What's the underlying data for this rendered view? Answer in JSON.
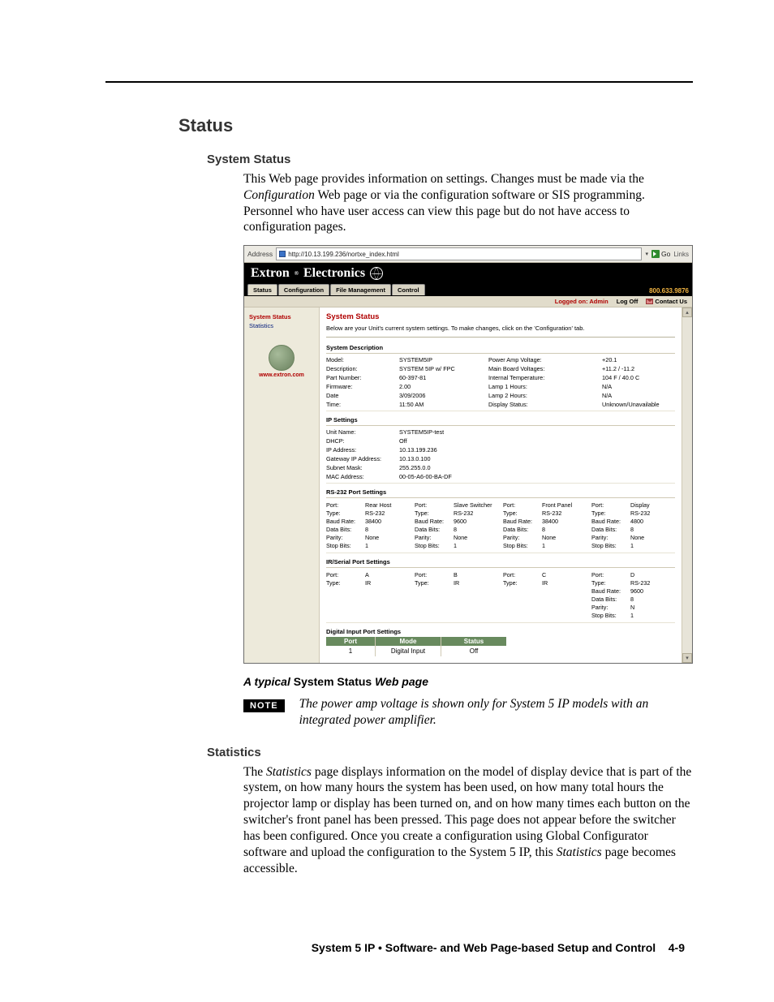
{
  "page": {
    "h1": "Status",
    "h2a": "System Status",
    "p1a": "This Web page provides information on settings.  Changes must be made via the ",
    "p1b": "Configuration",
    "p1c": " Web page or via the configuration software or SIS programming. Personnel who have user access can view this page but do not have access to configuration pages.",
    "caption_a": "A typical",
    "caption_b": " System Status ",
    "caption_c": "Web page",
    "note_label": "NOTE",
    "note_text": "The power amp voltage is shown only for System 5 IP models with an integrated power amplifier.",
    "h2b": "Statistics",
    "p2a": "The ",
    "p2b": "Statistics",
    "p2c": " page displays information on the model of display device that is part of the system, on how many hours the system has been used, on how many total hours the projector lamp or display has been turned on, and on how many times each button on the switcher's front panel has been pressed.  This page does not appear before the switcher has been configured.  Once you create a configuration using Global Configurator software and upload the configuration to the System 5 IP, this ",
    "p2d": "Statistics",
    "p2e": " page becomes accessible.",
    "footer_a": "System 5 IP • Software- and Web Page-based Setup and Control",
    "footer_b": "4-9"
  },
  "shot": {
    "addr_label": "Address",
    "addr_url": "http://10.13.199.236/nortxe_index.html",
    "go": "Go",
    "links": "Links",
    "brand_a": "Extron",
    "brand_b": "Electronics",
    "tabs": [
      "Status",
      "Configuration",
      "File Management",
      "Control"
    ],
    "phone": "800.633.9876",
    "logon": "Logged on: Admin",
    "logoff": "Log Off",
    "contact": "Contact Us",
    "side_links": [
      "System Status",
      "Statistics"
    ],
    "side_url": "www.extron.com",
    "main_title": "System Status",
    "main_sub": "Below are your Unit's current system settings. To make changes, click on the 'Configuration' tab.",
    "sys_desc_head": "System Description",
    "sys_left": [
      {
        "k": "Model:",
        "v": "SYSTEM5IP"
      },
      {
        "k": "Description:",
        "v": "SYSTEM 5IP w/ FPC"
      },
      {
        "k": "Part Number:",
        "v": "60-397-81"
      },
      {
        "k": "Firmware:",
        "v": "2.00"
      },
      {
        "k": "Date",
        "v": "3/09/2006"
      },
      {
        "k": "Time:",
        "v": "11:50 AM"
      }
    ],
    "sys_mid": [
      {
        "k": "Power Amp Voltage:",
        "v": "+20.1"
      },
      {
        "k": "Main Board Voltages:",
        "v": "+11.2 / -11.2"
      },
      {
        "k": "Internal Temperature:",
        "v": "104 F / 40.0 C"
      },
      {
        "k": "Lamp 1 Hours:",
        "v": "N/A"
      },
      {
        "k": "Lamp 2 Hours:",
        "v": "N/A"
      },
      {
        "k": "Display Status:",
        "v": "Unknown/Unavailable"
      }
    ],
    "ip_head": "IP Settings",
    "ip": [
      {
        "k": "Unit Name:",
        "v": "SYSTEM5IP-test"
      },
      {
        "k": "DHCP:",
        "v": "Off"
      },
      {
        "k": "IP Address:",
        "v": "10.13.199.236"
      },
      {
        "k": "Gateway IP Address:",
        "v": "10.13.0.100"
      },
      {
        "k": "Subnet Mask:",
        "v": "255.255.0.0"
      },
      {
        "k": "MAC Address:",
        "v": "00-05-A6-00-BA-DF"
      }
    ],
    "rs_head": "RS-232 Port Settings",
    "rs_ports": [
      [
        {
          "k": "Port:",
          "v": "Rear Host"
        },
        {
          "k": "Type:",
          "v": "RS-232"
        },
        {
          "k": "Baud Rate:",
          "v": "38400"
        },
        {
          "k": "Data Bits:",
          "v": "8"
        },
        {
          "k": "Parity:",
          "v": "None"
        },
        {
          "k": "Stop Bits:",
          "v": "1"
        }
      ],
      [
        {
          "k": "Port:",
          "v": "Slave Switcher"
        },
        {
          "k": "Type:",
          "v": "RS-232"
        },
        {
          "k": "Baud Rate:",
          "v": "9600"
        },
        {
          "k": "Data Bits:",
          "v": "8"
        },
        {
          "k": "Parity:",
          "v": "None"
        },
        {
          "k": "Stop Bits:",
          "v": "1"
        }
      ],
      [
        {
          "k": "Port:",
          "v": "Front Panel"
        },
        {
          "k": "Type:",
          "v": "RS-232"
        },
        {
          "k": "Baud Rate:",
          "v": "38400"
        },
        {
          "k": "Data Bits:",
          "v": "8"
        },
        {
          "k": "Parity:",
          "v": "None"
        },
        {
          "k": "Stop Bits:",
          "v": "1"
        }
      ],
      [
        {
          "k": "Port:",
          "v": "Display"
        },
        {
          "k": "Type:",
          "v": "RS-232"
        },
        {
          "k": "Baud Rate:",
          "v": "4800"
        },
        {
          "k": "Data Bits:",
          "v": "8"
        },
        {
          "k": "Parity:",
          "v": "None"
        },
        {
          "k": "Stop Bits:",
          "v": "1"
        }
      ]
    ],
    "ir_head": "IR/Serial Port Settings",
    "ir_ports": [
      [
        {
          "k": "Port:",
          "v": "A"
        },
        {
          "k": "Type:",
          "v": "IR"
        }
      ],
      [
        {
          "k": "Port:",
          "v": "B"
        },
        {
          "k": "Type:",
          "v": "IR"
        }
      ],
      [
        {
          "k": "Port:",
          "v": "C"
        },
        {
          "k": "Type:",
          "v": "IR"
        }
      ],
      [
        {
          "k": "Port:",
          "v": "D"
        },
        {
          "k": "Type:",
          "v": "RS-232"
        },
        {
          "k": "Baud Rate:",
          "v": "9600"
        },
        {
          "k": "Data Bits:",
          "v": "8"
        },
        {
          "k": "Parity:",
          "v": "N"
        },
        {
          "k": "Stop Bits:",
          "v": "1"
        }
      ]
    ],
    "dip_head": "Digital Input Port Settings",
    "dip_headers": [
      "Port",
      "Mode",
      "Status"
    ],
    "dip_row": [
      "1",
      "Digital Input",
      "Off"
    ]
  }
}
